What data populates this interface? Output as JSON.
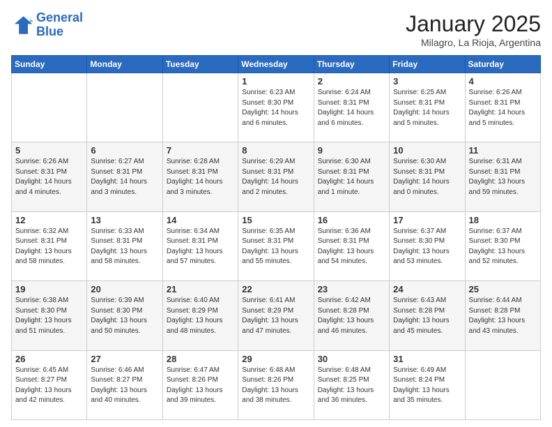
{
  "logo": {
    "line1": "General",
    "line2": "Blue"
  },
  "title": "January 2025",
  "location": "Milagro, La Rioja, Argentina",
  "weekdays": [
    "Sunday",
    "Monday",
    "Tuesday",
    "Wednesday",
    "Thursday",
    "Friday",
    "Saturday"
  ],
  "weeks": [
    [
      {
        "day": "",
        "info": ""
      },
      {
        "day": "",
        "info": ""
      },
      {
        "day": "",
        "info": ""
      },
      {
        "day": "1",
        "info": "Sunrise: 6:23 AM\nSunset: 8:30 PM\nDaylight: 14 hours\nand 6 minutes."
      },
      {
        "day": "2",
        "info": "Sunrise: 6:24 AM\nSunset: 8:31 PM\nDaylight: 14 hours\nand 6 minutes."
      },
      {
        "day": "3",
        "info": "Sunrise: 6:25 AM\nSunset: 8:31 PM\nDaylight: 14 hours\nand 5 minutes."
      },
      {
        "day": "4",
        "info": "Sunrise: 6:26 AM\nSunset: 8:31 PM\nDaylight: 14 hours\nand 5 minutes."
      }
    ],
    [
      {
        "day": "5",
        "info": "Sunrise: 6:26 AM\nSunset: 8:31 PM\nDaylight: 14 hours\nand 4 minutes."
      },
      {
        "day": "6",
        "info": "Sunrise: 6:27 AM\nSunset: 8:31 PM\nDaylight: 14 hours\nand 3 minutes."
      },
      {
        "day": "7",
        "info": "Sunrise: 6:28 AM\nSunset: 8:31 PM\nDaylight: 14 hours\nand 3 minutes."
      },
      {
        "day": "8",
        "info": "Sunrise: 6:29 AM\nSunset: 8:31 PM\nDaylight: 14 hours\nand 2 minutes."
      },
      {
        "day": "9",
        "info": "Sunrise: 6:30 AM\nSunset: 8:31 PM\nDaylight: 14 hours\nand 1 minute."
      },
      {
        "day": "10",
        "info": "Sunrise: 6:30 AM\nSunset: 8:31 PM\nDaylight: 14 hours\nand 0 minutes."
      },
      {
        "day": "11",
        "info": "Sunrise: 6:31 AM\nSunset: 8:31 PM\nDaylight: 13 hours\nand 59 minutes."
      }
    ],
    [
      {
        "day": "12",
        "info": "Sunrise: 6:32 AM\nSunset: 8:31 PM\nDaylight: 13 hours\nand 58 minutes."
      },
      {
        "day": "13",
        "info": "Sunrise: 6:33 AM\nSunset: 8:31 PM\nDaylight: 13 hours\nand 58 minutes."
      },
      {
        "day": "14",
        "info": "Sunrise: 6:34 AM\nSunset: 8:31 PM\nDaylight: 13 hours\nand 57 minutes."
      },
      {
        "day": "15",
        "info": "Sunrise: 6:35 AM\nSunset: 8:31 PM\nDaylight: 13 hours\nand 55 minutes."
      },
      {
        "day": "16",
        "info": "Sunrise: 6:36 AM\nSunset: 8:31 PM\nDaylight: 13 hours\nand 54 minutes."
      },
      {
        "day": "17",
        "info": "Sunrise: 6:37 AM\nSunset: 8:30 PM\nDaylight: 13 hours\nand 53 minutes."
      },
      {
        "day": "18",
        "info": "Sunrise: 6:37 AM\nSunset: 8:30 PM\nDaylight: 13 hours\nand 52 minutes."
      }
    ],
    [
      {
        "day": "19",
        "info": "Sunrise: 6:38 AM\nSunset: 8:30 PM\nDaylight: 13 hours\nand 51 minutes."
      },
      {
        "day": "20",
        "info": "Sunrise: 6:39 AM\nSunset: 8:30 PM\nDaylight: 13 hours\nand 50 minutes."
      },
      {
        "day": "21",
        "info": "Sunrise: 6:40 AM\nSunset: 8:29 PM\nDaylight: 13 hours\nand 48 minutes."
      },
      {
        "day": "22",
        "info": "Sunrise: 6:41 AM\nSunset: 8:29 PM\nDaylight: 13 hours\nand 47 minutes."
      },
      {
        "day": "23",
        "info": "Sunrise: 6:42 AM\nSunset: 8:28 PM\nDaylight: 13 hours\nand 46 minutes."
      },
      {
        "day": "24",
        "info": "Sunrise: 6:43 AM\nSunset: 8:28 PM\nDaylight: 13 hours\nand 45 minutes."
      },
      {
        "day": "25",
        "info": "Sunrise: 6:44 AM\nSunset: 8:28 PM\nDaylight: 13 hours\nand 43 minutes."
      }
    ],
    [
      {
        "day": "26",
        "info": "Sunrise: 6:45 AM\nSunset: 8:27 PM\nDaylight: 13 hours\nand 42 minutes."
      },
      {
        "day": "27",
        "info": "Sunrise: 6:46 AM\nSunset: 8:27 PM\nDaylight: 13 hours\nand 40 minutes."
      },
      {
        "day": "28",
        "info": "Sunrise: 6:47 AM\nSunset: 8:26 PM\nDaylight: 13 hours\nand 39 minutes."
      },
      {
        "day": "29",
        "info": "Sunrise: 6:48 AM\nSunset: 8:26 PM\nDaylight: 13 hours\nand 38 minutes."
      },
      {
        "day": "30",
        "info": "Sunrise: 6:48 AM\nSunset: 8:25 PM\nDaylight: 13 hours\nand 36 minutes."
      },
      {
        "day": "31",
        "info": "Sunrise: 6:49 AM\nSunset: 8:24 PM\nDaylight: 13 hours\nand 35 minutes."
      },
      {
        "day": "",
        "info": ""
      }
    ]
  ]
}
